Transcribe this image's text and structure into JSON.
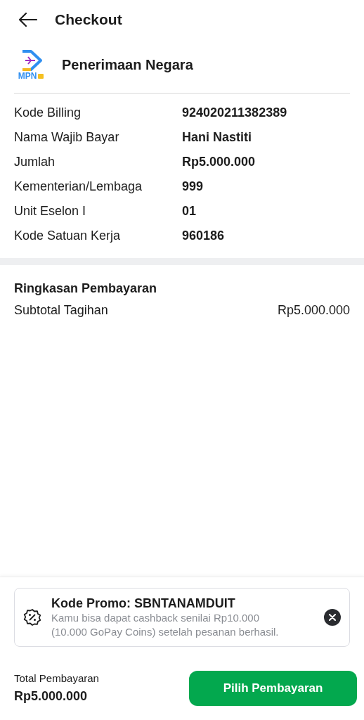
{
  "header": {
    "title": "Checkout"
  },
  "merchant": {
    "logo_text": "MPN",
    "name": "Penerimaan Negara"
  },
  "details": [
    {
      "label": "Kode Billing",
      "value": "924020211382389"
    },
    {
      "label": "Nama Wajib Bayar",
      "value": "Hani Nastiti"
    },
    {
      "label": "Jumlah",
      "value": "Rp5.000.000"
    },
    {
      "label": "Kementerian/Lembaga",
      "value": "999"
    },
    {
      "label": "Unit Eselon I",
      "value": "01"
    },
    {
      "label": "Kode Satuan Kerja",
      "value": "960186"
    }
  ],
  "summary": {
    "title": "Ringkasan Pembayaran",
    "rows": [
      {
        "label": "Subtotal Tagihan",
        "value": "Rp5.000.000"
      }
    ]
  },
  "promo": {
    "title": "Kode Promo: SBNTANAMDUIT",
    "description": "Kamu bisa dapat cashback senilai Rp10.000 (10.000 GoPay Coins) setelah pesanan berhasil."
  },
  "footer": {
    "total_label": "Total Pembayaran",
    "total_value": "Rp5.000.000",
    "button": "Pilih Pembayaran"
  }
}
